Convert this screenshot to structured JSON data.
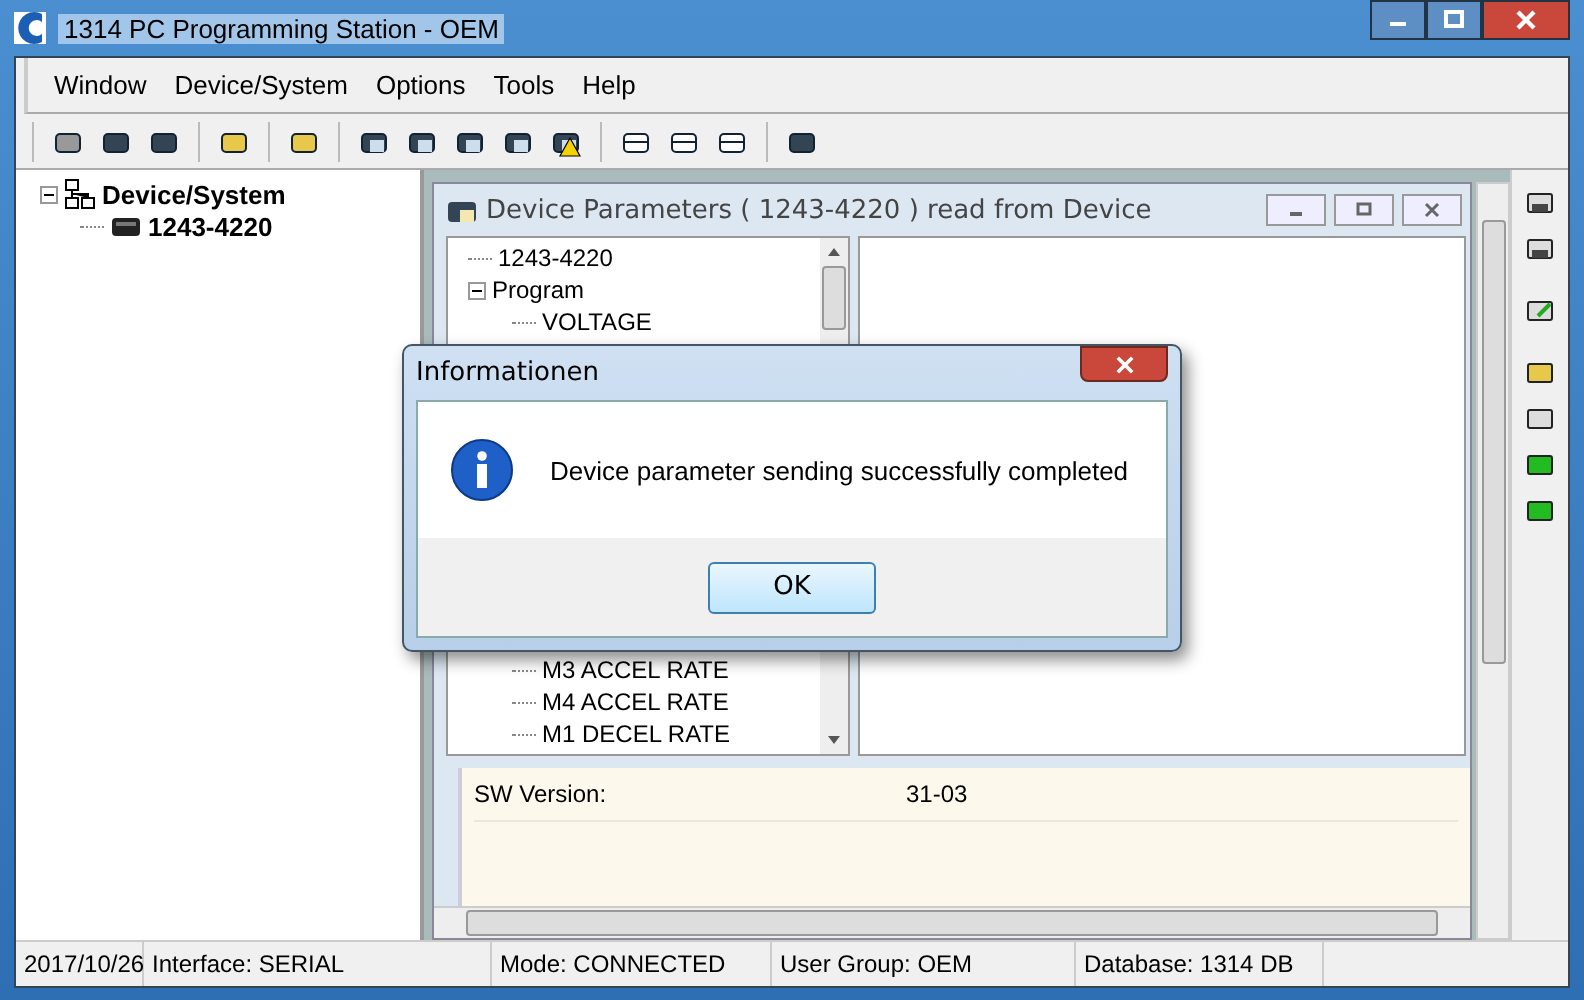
{
  "window": {
    "title": "1314 PC Programming Station - OEM"
  },
  "menu": [
    "Window",
    "Device/System",
    "Options",
    "Tools",
    "Help"
  ],
  "device_tree": {
    "label": "Device/System",
    "expanded": true,
    "children": [
      {
        "label": "1243-4220"
      }
    ]
  },
  "child_window": {
    "title": "Device Parameters ( 1243-4220 ) read from Device",
    "tree": [
      {
        "label": "1243-4220"
      },
      {
        "label": "Program",
        "expanded": true,
        "children": [
          {
            "label": "VOLTAGE"
          },
          {
            "label": "M3 ACCEL RATE"
          },
          {
            "label": "M4 ACCEL RATE"
          },
          {
            "label": "M1 DECEL RATE"
          }
        ]
      }
    ],
    "info": [
      {
        "label": "SW Version:",
        "value": "31-03"
      }
    ]
  },
  "dialog": {
    "title": "Informationen",
    "message": "Device parameter sending successfully completed",
    "button": "OK"
  },
  "status_bar": [
    "2017/10/26",
    "Interface: SERIAL",
    "Mode: CONNECTED",
    "User Group: OEM",
    "Database: 1314 DB"
  ]
}
